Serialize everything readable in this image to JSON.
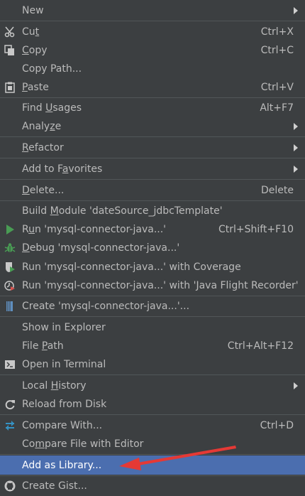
{
  "menu": {
    "new": "New",
    "cut": {
      "pre": "Cu",
      "u": "t",
      "post": "",
      "shortcut": "Ctrl+X"
    },
    "copy": {
      "pre": "",
      "u": "C",
      "post": "opy",
      "shortcut": "Ctrl+C"
    },
    "copy_path": "Copy Path...",
    "paste": {
      "pre": "",
      "u": "P",
      "post": "aste",
      "shortcut": "Ctrl+V"
    },
    "find_usages": {
      "pre": "Find ",
      "u": "U",
      "post": "sages",
      "shortcut": "Alt+F7"
    },
    "analyze": {
      "pre": "Analy",
      "u": "z",
      "post": "e"
    },
    "refactor": {
      "pre": "",
      "u": "R",
      "post": "efactor"
    },
    "add_to_favorites": {
      "pre": "Add to F",
      "u": "a",
      "post": "vorites"
    },
    "delete": {
      "pre": "",
      "u": "D",
      "post": "elete...",
      "shortcut": "Delete"
    },
    "build_module": {
      "pre": "Build ",
      "u": "M",
      "post": "odule 'dateSource_jdbcTemplate'"
    },
    "run": {
      "pre": "R",
      "u": "u",
      "post": "n 'mysql-connector-java...'",
      "shortcut": "Ctrl+Shift+F10"
    },
    "debug": {
      "pre": "",
      "u": "D",
      "post": "ebug 'mysql-connector-java...'"
    },
    "run_coverage": "Run 'mysql-connector-java...' with Coverage",
    "run_jfr": "Run 'mysql-connector-java...' with 'Java Flight Recorder'",
    "create": "Create 'mysql-connector-java...'...",
    "show_in_explorer": "Show in Explorer",
    "file_path": {
      "pre": "File ",
      "u": "P",
      "post": "ath",
      "shortcut": "Ctrl+Alt+F12"
    },
    "open_in_terminal": "Open in Terminal",
    "local_history": {
      "pre": "Local ",
      "u": "H",
      "post": "istory"
    },
    "reload_from_disk": "Reload from Disk",
    "compare_with": {
      "label": "Compare With...",
      "shortcut": "Ctrl+D"
    },
    "compare_file": {
      "pre": "Co",
      "u": "m",
      "post": "pare File with Editor"
    },
    "add_as_library": "Add as Library...",
    "create_gist": "Create Gist..."
  },
  "colors": {
    "background": "#3c3f41",
    "selection": "#4b6eaf",
    "separator": "#515658",
    "annotation_arrow": "#e53935"
  }
}
